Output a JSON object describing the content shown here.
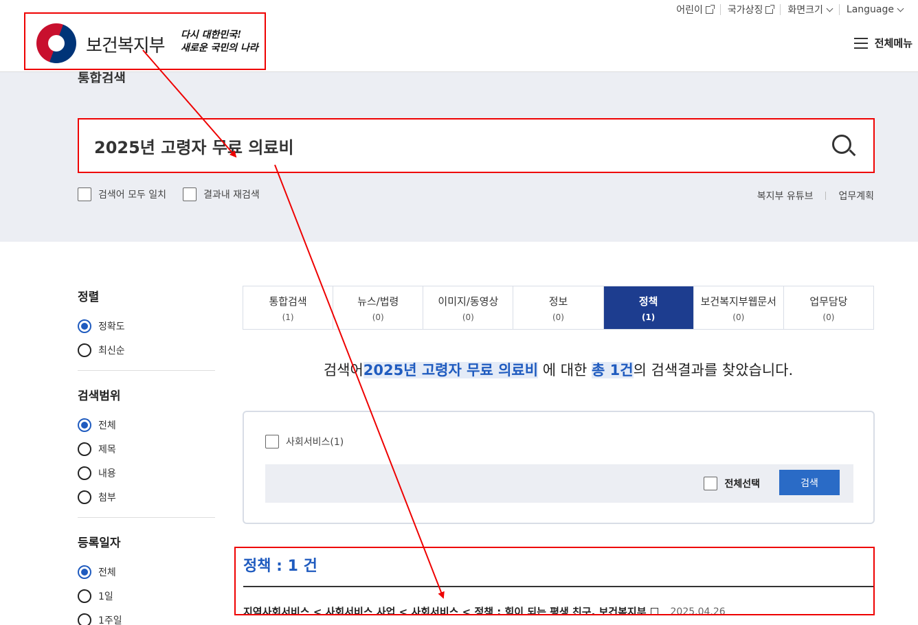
{
  "header": {
    "util_links": [
      {
        "label": "어린이",
        "icon": "external-link-icon"
      },
      {
        "label": "국가상징",
        "icon": "external-link-icon"
      },
      {
        "label": "화면크기",
        "icon": "chevron-down-icon"
      },
      {
        "label": "Language",
        "icon": "chevron-down-icon"
      }
    ],
    "logo_text": "보건복지부",
    "slogan_line1": "다시 대한민국!",
    "slogan_line2": "새로운 국민의 나라",
    "all_menu_label": "전체메뉴"
  },
  "search": {
    "section_title": "통합검색",
    "query": "2025년 고령자 무료 의료비",
    "option_exact": "검색어 모두 일치",
    "option_within": "결과내 재검색",
    "links": [
      "복지부 유튜브",
      "업무계획"
    ]
  },
  "sidebar": {
    "sort": {
      "title": "정렬",
      "options": [
        "정확도",
        "최신순"
      ],
      "selected": "정확도"
    },
    "scope": {
      "title": "검색범위",
      "options": [
        "전체",
        "제목",
        "내용",
        "첨부"
      ],
      "selected": "전체"
    },
    "date": {
      "title": "등록일자",
      "options": [
        "전체",
        "1일",
        "1주일"
      ],
      "selected": "전체"
    }
  },
  "tabs": [
    {
      "label": "통합검색",
      "count": "(1)"
    },
    {
      "label": "뉴스/법령",
      "count": "(0)"
    },
    {
      "label": "이미지/동영상",
      "count": "(0)"
    },
    {
      "label": "정보",
      "count": "(0)"
    },
    {
      "label": "정책",
      "count": "(1)",
      "active": true
    },
    {
      "label": "보건복지부웹문서",
      "count": "(0)"
    },
    {
      "label": "업무담당",
      "count": "(0)"
    }
  ],
  "summary": {
    "prefix": "검색어",
    "query": "2025년 고령자 무료 의료비",
    "middle": " 에 대한 ",
    "total": "총 1건",
    "suffix": "의 검색결과를 찾았습니다."
  },
  "filter": {
    "category": "사회서비스(1)",
    "select_all": "전체선택",
    "search_button": "검색"
  },
  "result": {
    "section_title": "정책 : 1 건",
    "items": [
      {
        "title": "지역사회서비스 < 사회서비스 사업 < 사회서비스 < 정책 : 힘이 되는 평생 친구, 보건복지부",
        "date": "2025.04.26"
      }
    ]
  },
  "colors": {
    "accent_blue": "#1f5bbf",
    "active_tab": "#1d3d8f",
    "annotation_red": "#e00000",
    "band_bg": "#eceef3"
  }
}
